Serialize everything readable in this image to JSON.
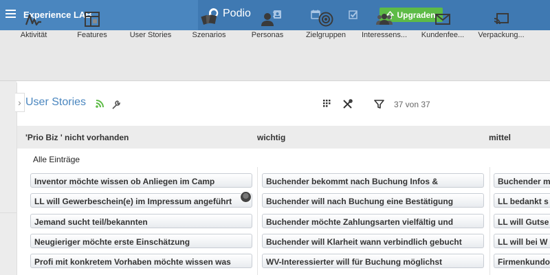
{
  "topbar": {
    "workspace": "Experience LAB",
    "brand": "Podio",
    "upgrade_label": "Upgraden"
  },
  "apps": [
    {
      "label": "Aktivität",
      "icon": "activity-icon"
    },
    {
      "label": "Features",
      "icon": "layout-icon"
    },
    {
      "label": "User Stories",
      "icon": "wave-icon"
    },
    {
      "label": "Szenarios",
      "icon": "cards-icon"
    },
    {
      "label": "Personas",
      "icon": "person-icon"
    },
    {
      "label": "Zielgruppen",
      "icon": "target-icon"
    },
    {
      "label": "Interessens...",
      "icon": "group-icon"
    },
    {
      "label": "Kundenfee...",
      "icon": "mail-icon"
    },
    {
      "label": "Verpackung...",
      "icon": "cast-icon"
    }
  ],
  "view": {
    "title": "User Stories",
    "count": "37 von 37",
    "filter_label": "Alle Einträge"
  },
  "columns": [
    {
      "title": "'Prio Biz ' nicht vorhanden",
      "cards": [
        "Inventor möchte wissen ob Anliegen im Camp",
        "LL will Gewerbeschein(e) im Impressum angeführt",
        "Jemand sucht teil/bekannten",
        "Neugieriger möchte erste Einschätzung",
        "Profi mit konkretem Vorhaben möchte wissen was"
      ]
    },
    {
      "title": "wichtig",
      "cards": [
        "Buchender bekommt nach Buchung Infos &",
        "Buchender will nach Buchung eine Bestätigung",
        "Buchender möchte Zahlungsarten vielfältig und",
        "Buchender will Klarheit wann verbindlich gebucht",
        "WV-Interessierter will für Buchung möglichst"
      ]
    },
    {
      "title": "mittel",
      "cards": [
        "Buchender m",
        "LL bedankt s",
        "LL will Gutse",
        "LL will bei W",
        "Firmenkundo"
      ]
    }
  ],
  "colors": {
    "topbar": "#4a86bf",
    "accent": "#4a86bf",
    "upgrade": "#5dbb46"
  }
}
